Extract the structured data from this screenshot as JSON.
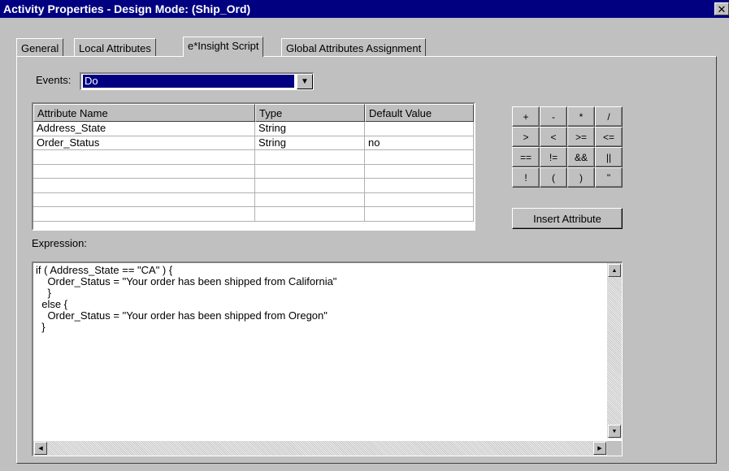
{
  "window": {
    "title": "Activity Properties - Design Mode: (Ship_Ord)",
    "close_icon": "close-icon"
  },
  "tabs": [
    {
      "label": "General",
      "active": false
    },
    {
      "label": "Local Attributes",
      "active": false
    },
    {
      "label": "e*Insight Script",
      "active": true
    },
    {
      "label": "Global Attributes Assignment",
      "active": false
    }
  ],
  "events": {
    "label": "Events:",
    "value": "Do"
  },
  "attributes_table": {
    "columns": [
      "Attribute Name",
      "Type",
      "Default Value"
    ],
    "rows": [
      [
        "Address_State",
        "String",
        ""
      ],
      [
        "Order_Status",
        "String",
        "no"
      ],
      [
        "",
        "",
        ""
      ],
      [
        "",
        "",
        ""
      ],
      [
        "",
        "",
        ""
      ],
      [
        "",
        "",
        ""
      ],
      [
        "",
        "",
        ""
      ]
    ]
  },
  "operators": [
    "+",
    "-",
    "*",
    "/",
    ">",
    "<",
    ">=",
    "<=",
    "==",
    "!=",
    "&&",
    "||",
    "!",
    "(",
    ")",
    "\""
  ],
  "insert_attribute_label": "Insert Attribute",
  "expression": {
    "label": "Expression:",
    "text": "if ( Address_State == \"CA\" ) {\n    Order_Status = \"Your order has been shipped from California\"\n    }\n  else {\n    Order_Status = \"Your order has been shipped from Oregon\"\n  }"
  }
}
